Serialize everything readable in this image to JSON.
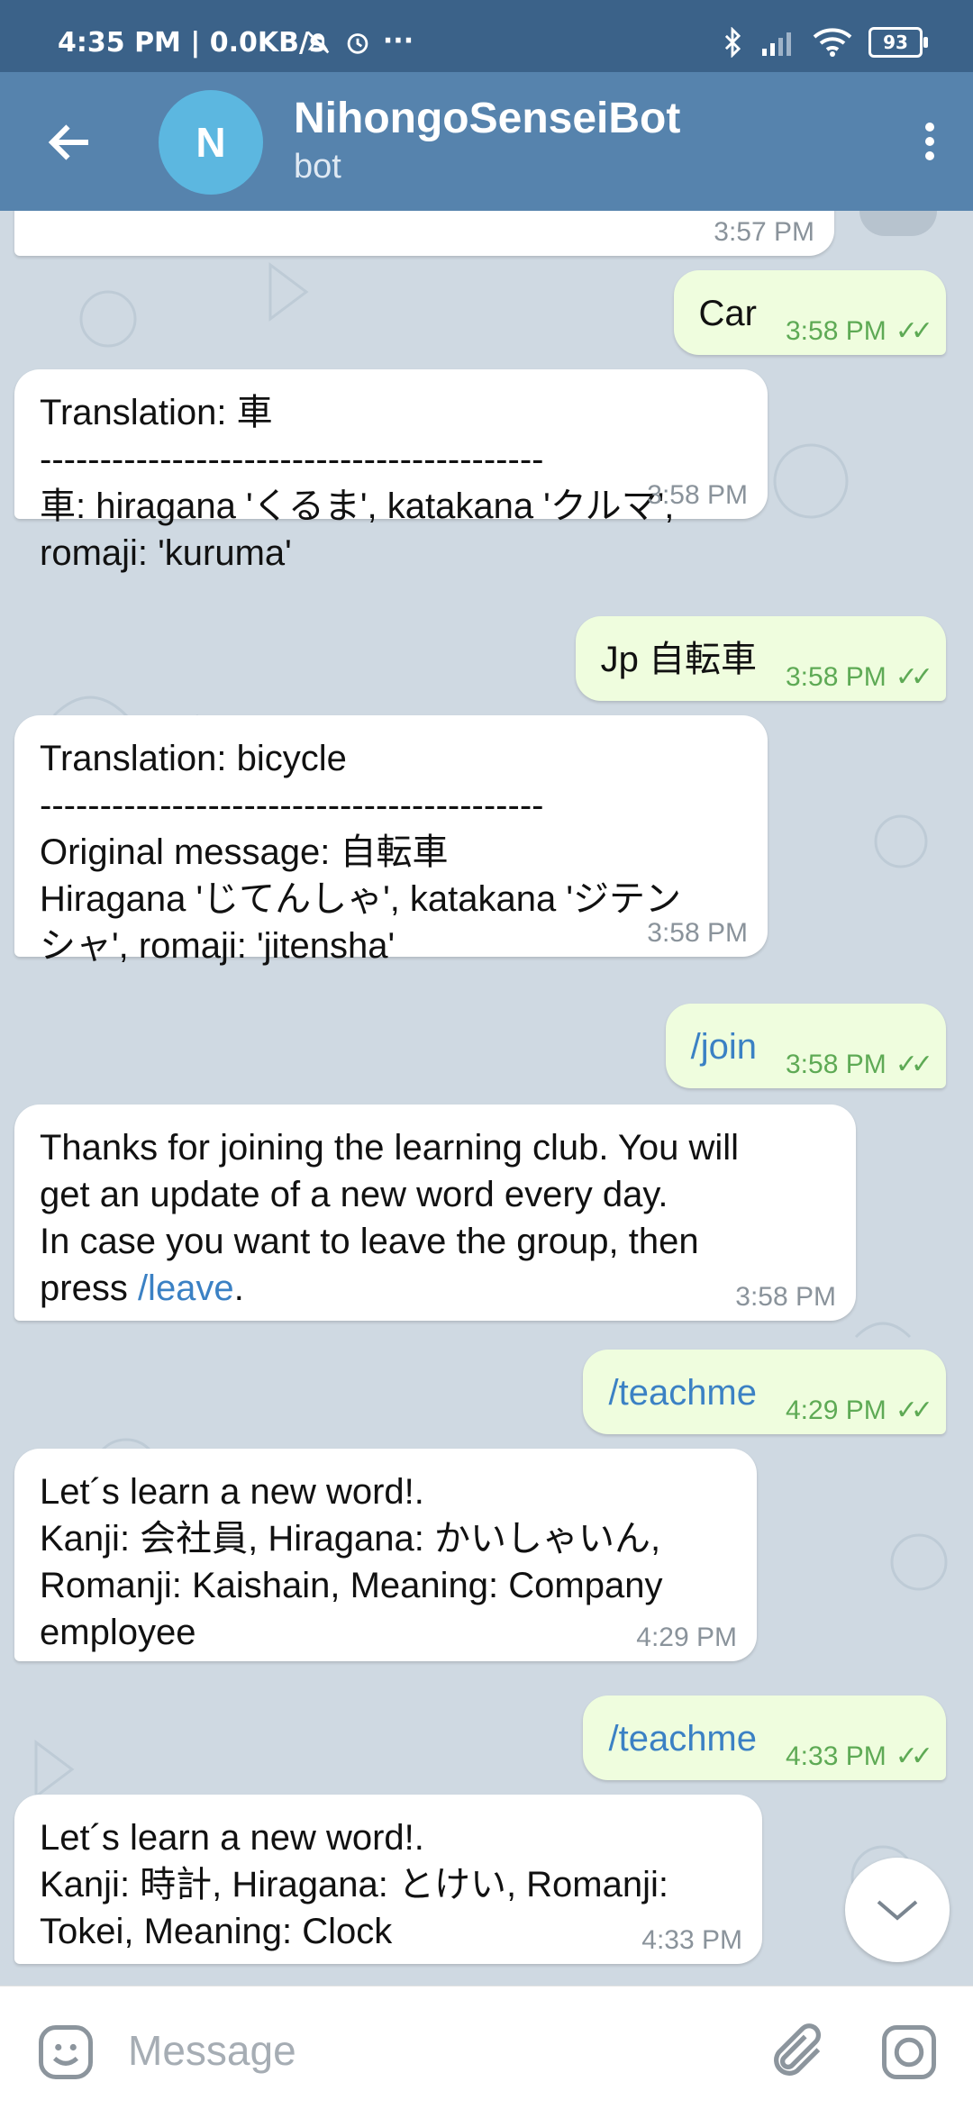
{
  "status_bar": {
    "time": "4:35 PM | 0.0KB/s",
    "extra": "···",
    "battery": "93"
  },
  "header": {
    "avatar_letter": "N",
    "title": "NihongoSenseiBot",
    "subtitle": "bot"
  },
  "messages": [
    {
      "dir": "in",
      "text": "",
      "time": "3:57 PM"
    },
    {
      "dir": "out",
      "text": "Car",
      "time": "3:58 PM"
    },
    {
      "dir": "in",
      "text": "Translation: 車\n------------------------------------------\n車: hiragana 'くるま', katakana 'クルマ',\nromaji: 'kuruma'",
      "time": "3:58 PM"
    },
    {
      "dir": "out",
      "text": "Jp 自転車",
      "time": "3:58 PM"
    },
    {
      "dir": "in",
      "text": "Translation: bicycle\n------------------------------------------\nOriginal message: 自転車\nHiragana 'じてんしゃ', katakana 'ジテン\nシャ', romaji: 'jitensha'",
      "time": "3:58 PM"
    },
    {
      "dir": "out",
      "text": "/join",
      "time": "3:58 PM"
    },
    {
      "dir": "in",
      "text_before": "Thanks for joining the learning club. You will\nget an update of a new word every day.\nIn case you want to leave the group, then\npress ",
      "link": "/leave",
      "text_after": ".",
      "time": "3:58 PM"
    },
    {
      "dir": "out",
      "text": "/teachme",
      "time": "4:29 PM"
    },
    {
      "dir": "in",
      "text": "Let´s learn a new word!.\nKanji: 会社員, Hiragana: かいしゃいん,\nRomanji: Kaishain, Meaning: Company\nemployee",
      "time": "4:29 PM"
    },
    {
      "dir": "out",
      "text": "/teachme",
      "time": "4:33 PM"
    },
    {
      "dir": "in",
      "text": "Let´s learn a new word!.\nKanji: 時計, Hiragana: とけい, Romanji:\nTokei, Meaning: Clock",
      "time": "4:33 PM"
    }
  ],
  "input": {
    "placeholder": "Message"
  }
}
